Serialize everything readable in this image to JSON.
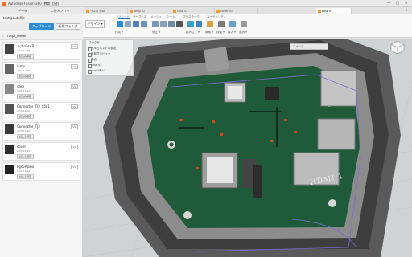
{
  "window": {
    "title": "Autodesk Fusion 360 (教育 用途)",
    "controls": [
      "—",
      "▢",
      "✕"
    ]
  },
  "data_panel": {
    "tabs": [
      "データ",
      "人物メンバー"
    ],
    "project": "test@autofile",
    "upload_label": "アップロード",
    "new_folder_label": "新規フォルダ",
    "folder_name": "raspi_meter",
    "items": [
      {
        "name": "ラズパイ4B",
        "date": "2:30 12/15",
        "status": "読込み保存",
        "version": "V1",
        "thumb": "#444444"
      },
      {
        "name": "lamp",
        "date": "2:31 12/16",
        "status": "読込み保存",
        "version": "V1",
        "thumb": "#666666"
      },
      {
        "name": "case",
        "date": "1:21 12/10",
        "status": "読込み保存",
        "version": "V1",
        "thumb": "#888888"
      },
      {
        "name": "Connector_TJ3_0581",
        "date": "2:30 12/10",
        "status": "読込み保存",
        "version": "V1",
        "thumb": "#555555"
      },
      {
        "name": "Connector_TJ3",
        "date": "2:30 12/10",
        "status": "読込み保存",
        "version": "V1",
        "thumb": "#3a3a3a"
      },
      {
        "name": "cover",
        "date": "2:30 12/10",
        "status": "読込み保存",
        "version": "V1",
        "thumb": "#2e2e2e"
      },
      {
        "name": "Pgc5Rpibo",
        "date": "1:21 12/10",
        "status": "読込み保存",
        "version": "V1",
        "thumb": "#222222"
      }
    ]
  },
  "doc_tabs": [
    "ラズパイ4B",
    "lamp v2",
    "case v3",
    "cover v1",
    "case v7"
  ],
  "toolbar": {
    "workspace": "デザイン ▾",
    "tabs": [
      "ソリッド",
      "サーフェス",
      "メッシュ",
      "シート",
      "プラスチック",
      "ユーティリティ"
    ],
    "groups": [
      "作成 ▾",
      "修正 ▾",
      "組み立て ▾",
      "構築 ▾",
      "検査 ▾",
      "挿入 ▾",
      "選択 ▾"
    ]
  },
  "browser": {
    "title": "ブラウザ",
    "items": [
      "ドキュメントの設定",
      "名前付きビュー",
      "原点",
      "case v3",
      "raspi4B v1"
    ]
  },
  "comments_label": "コメント",
  "board_label": "HDMI 1",
  "colors": {
    "accent": "#2b8cd8",
    "board": "#1f5a3a",
    "case": "#4a4a4a"
  }
}
